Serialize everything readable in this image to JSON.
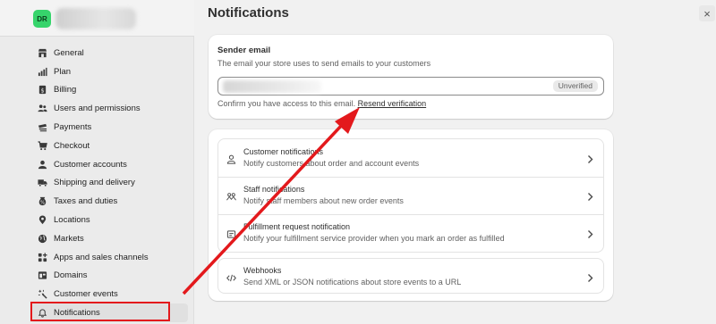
{
  "sidebar": {
    "avatar_initials": "DR",
    "items": [
      {
        "label": "General",
        "icon": "store-icon"
      },
      {
        "label": "Plan",
        "icon": "chart-icon"
      },
      {
        "label": "Billing",
        "icon": "billing-icon"
      },
      {
        "label": "Users and permissions",
        "icon": "users-icon"
      },
      {
        "label": "Payments",
        "icon": "payments-icon"
      },
      {
        "label": "Checkout",
        "icon": "cart-icon"
      },
      {
        "label": "Customer accounts",
        "icon": "person-icon"
      },
      {
        "label": "Shipping and delivery",
        "icon": "truck-icon"
      },
      {
        "label": "Taxes and duties",
        "icon": "tax-icon"
      },
      {
        "label": "Locations",
        "icon": "location-icon"
      },
      {
        "label": "Markets",
        "icon": "globe-icon"
      },
      {
        "label": "Apps and sales channels",
        "icon": "apps-icon"
      },
      {
        "label": "Domains",
        "icon": "domains-icon"
      },
      {
        "label": "Customer events",
        "icon": "sparkle-icon"
      },
      {
        "label": "Notifications",
        "icon": "bell-icon",
        "active": true
      }
    ]
  },
  "main": {
    "title": "Notifications",
    "close_label": "×",
    "sender": {
      "title": "Sender email",
      "description": "The email your store uses to send emails to your customers",
      "email_status": "Unverified",
      "confirm_text": "Confirm you have access to this email.",
      "resend_link": "Resend verification"
    },
    "notification_groups": [
      {
        "title": "Customer notifications",
        "description": "Notify customers about order and account events",
        "icon": "person-icon"
      },
      {
        "title": "Staff notifications",
        "description": "Notify staff members about new order events",
        "icon": "staff-icon"
      },
      {
        "title": "Fulfillment request notification",
        "description": "Notify your fulfillment service provider when you mark an order as fulfilled",
        "icon": "fulfillment-icon"
      }
    ],
    "webhooks": {
      "title": "Webhooks",
      "description": "Send XML or JSON notifications about store events to a URL",
      "icon": "code-icon"
    }
  },
  "annotation": {
    "color": "#e3191c"
  }
}
